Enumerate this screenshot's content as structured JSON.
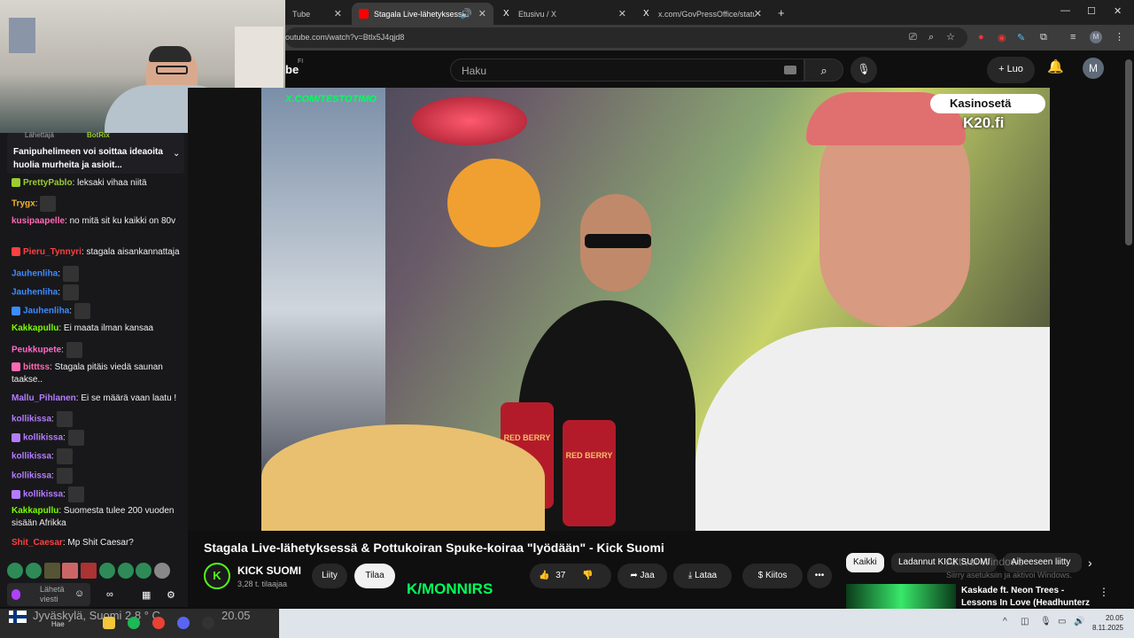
{
  "browser": {
    "tabs": [
      {
        "title": "Tube",
        "icon": "youtube-icon"
      },
      {
        "title": "Stagala Live-lähetyksessä &",
        "icon": "youtube-icon",
        "active": true
      },
      {
        "title": "Etusivu / X",
        "icon": "x-icon"
      },
      {
        "title": "x.com/GovPressOffice/status/1!",
        "icon": "x-icon"
      }
    ],
    "url": "outube.com/watch?v=Btlx5J4qjd8",
    "profile": "M"
  },
  "youtube": {
    "logo_text": "be",
    "region": "FI",
    "search_placeholder": "Haku",
    "create_label": "Luo",
    "avatar": "M"
  },
  "video": {
    "watermark_url": "X.COM/TESTOTIMO",
    "overlay_brand": "Kasinosetä",
    "overlay_domain": "K20.fi",
    "can_text": "RED BERRY"
  },
  "meta": {
    "title": "Stagala Live-lähetyksessä & Pottukoiran Spuke-koiraa \"lyödään\" - Kick Suomi",
    "channel": "KICK SUOMI",
    "subscribers": "3,28 t. tilaajaa",
    "join_label": "Liity",
    "subscribe_label": "Tilaa",
    "likes": "37",
    "share_label": "Jaa",
    "download_label": "Lataa",
    "thanks_label": "Kiitos",
    "chips": [
      "Kaikki",
      "Ladannut KICK SUOMI",
      "Aiheeseen liitty"
    ],
    "rec_title_1": "Kaskade ft. Neon Trees -",
    "rec_title_2": "Lessons In Love (Headhunterz",
    "windows_watermark_1": "Aktivoi Windows",
    "windows_watermark_2": "Siirry asetuksiin ja aktivoi Windows."
  },
  "chat": {
    "pinned_header": "Lähettäjä",
    "pinned_user": "BotRix",
    "pinned_text": "Fanipuhelimeen voi soittaa ideaoita huolia murheita ja asioit...",
    "messages": [
      {
        "user": "PrettyPablo",
        "text": "leksaki vihaa niitä",
        "color": "#9acd32"
      },
      {
        "user": "Trygx",
        "text": "",
        "color": "#f0b429"
      },
      {
        "user": "kusipaapelle",
        "text": "no mitä sit ku kaikki on 80v",
        "color": "#ff69b4"
      },
      {
        "user": "Pieru_Tynnyri",
        "text": "stagala aisankannattaja",
        "color": "#ff4040"
      },
      {
        "user": "Jauhenliha",
        "text": "",
        "color": "#3c8cff"
      },
      {
        "user": "Jauhenliha",
        "text": "",
        "color": "#3c8cff"
      },
      {
        "user": "Jauhenliha",
        "text": "",
        "color": "#3c8cff"
      },
      {
        "user": "Kakkapullu",
        "text": "Ei maata ilman kansaa",
        "color": "#7cfc00"
      },
      {
        "user": "Peukkupete",
        "text": "",
        "color": "#ff6bcb"
      },
      {
        "user": "bitttss",
        "text": "Stagala pitäis viedä saunan taakse..",
        "color": "#ff69b4"
      },
      {
        "user": "Mallu_Pihlanen",
        "text": "Ei se määrä vaan laatu !",
        "color": "#b57cff"
      },
      {
        "user": "kollikissa",
        "text": "",
        "color": "#b57cff"
      },
      {
        "user": "kollikissa",
        "text": "",
        "color": "#b57cff"
      },
      {
        "user": "kollikissa",
        "text": "",
        "color": "#b57cff"
      },
      {
        "user": "kollikissa",
        "text": "",
        "color": "#b57cff"
      },
      {
        "user": "kollikissa",
        "text": "",
        "color": "#b57cff"
      },
      {
        "user": "Kakkapullu",
        "text": "Suomesta tulee 200 vuoden sisään Afrikka",
        "color": "#7cfc00"
      },
      {
        "user": "Shit_Caesar",
        "text": "Mp Shit Caesar?",
        "color": "#ff4040"
      }
    ],
    "send_placeholder": "Lähetä viesti"
  },
  "stream_overlay": {
    "weather": "Jyväskylä, Suomi  2,8 ° C",
    "time": "20.05",
    "brand": "K/MONNIRS"
  },
  "taskbar": {
    "search_label": "Hae",
    "clock": "20.05",
    "date": "8.11.2025"
  }
}
